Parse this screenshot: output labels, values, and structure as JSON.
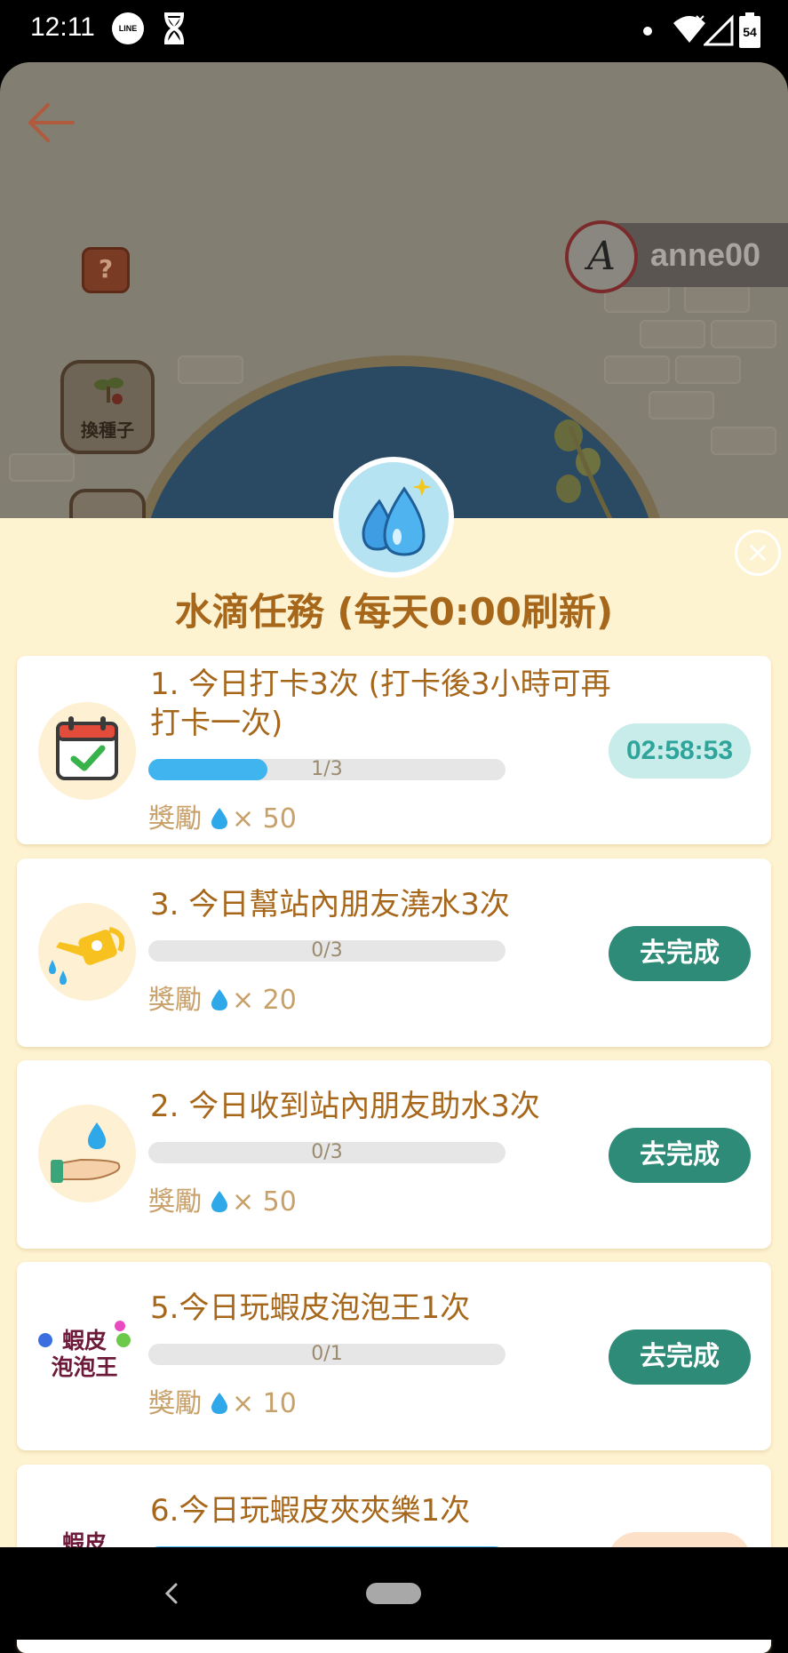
{
  "status_bar": {
    "time": "12:11",
    "line_label": "LINE",
    "battery": "54",
    "icons": [
      "line-icon",
      "hourglass-icon",
      "dot-icon",
      "wifi-icon",
      "signal-icon",
      "battery-icon"
    ]
  },
  "game": {
    "help_label": "?",
    "seed_button_label": "換種子",
    "username": "anne00",
    "avatar_letter": "A"
  },
  "panel": {
    "title": "水滴任務 (每天0:00刷新)",
    "close_symbol": "×",
    "reward_label": "獎勵",
    "tasks": [
      {
        "title": "1. 今日打卡3次 (打卡後3小時可再打卡一次)",
        "progress_text": "1/3",
        "progress": 0.333,
        "reward": "× 50",
        "action": "02:58:53",
        "icon": "calendar-check-icon"
      },
      {
        "title": "3. 今日幫站內朋友澆水3次",
        "progress_text": "0/3",
        "progress": 0,
        "reward": "× 20",
        "action": "去完成",
        "icon": "watering-can-icon"
      },
      {
        "title": "2. 今日收到站內朋友助水3次",
        "progress_text": "0/3",
        "progress": 0,
        "reward": "× 50",
        "action": "去完成",
        "icon": "hand-water-drop-icon"
      },
      {
        "title": "5.今日玩蝦皮泡泡王1次",
        "progress_text": "0/1",
        "progress": 0,
        "reward": "× 10",
        "action": "去完成",
        "icon": "shopee-bubble-game-icon",
        "icon_text": [
          "蝦皮",
          "泡泡王"
        ]
      },
      {
        "title": "6.今日玩蝦皮夾夾樂1次",
        "icon": "shopee-claw-game-icon",
        "icon_text": "蝦皮"
      }
    ]
  },
  "colors": {
    "panel_bg": "#fef3d1",
    "title_brown": "#a7671b",
    "action_green": "#2d8b78",
    "timer_bg": "#c7ece9",
    "progress_blue": "#3fb4ee"
  }
}
